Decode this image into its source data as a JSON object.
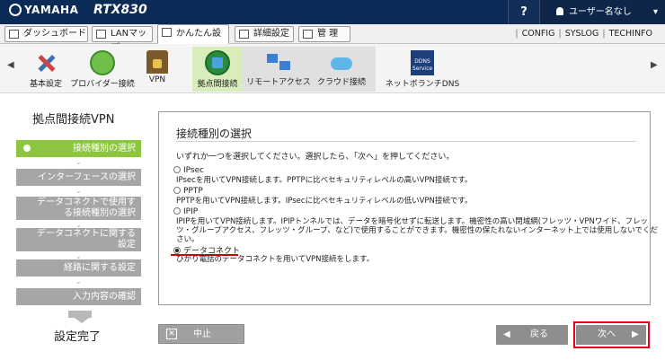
{
  "header": {
    "brand": "YAMAHA",
    "model": "RTX830",
    "help": "?",
    "user": "ユーザー名なし",
    "user_caret": "▾"
  },
  "tabs": [
    {
      "label": "ダッシュボード"
    },
    {
      "label": "LANマップ"
    },
    {
      "label": "かんたん設定"
    },
    {
      "label": "詳細設定"
    },
    {
      "label": "管 理"
    }
  ],
  "links": [
    "CONFIG",
    "SYSLOG",
    "TECHINFO"
  ],
  "icon_strip": {
    "prev": "◀",
    "next": "▶",
    "items": [
      {
        "label": "基本設定",
        "icon": "tools-icon"
      },
      {
        "label": "プロバイダー接続",
        "icon": "globe-icon"
      },
      {
        "label": "VPN",
        "icon": "lock-house-icon"
      },
      {
        "label": "拠点間接続",
        "icon": "site-to-site-icon"
      },
      {
        "label": "リモートアクセス",
        "icon": "remote-access-icon"
      },
      {
        "label": "クラウド接続",
        "icon": "cloud-icon"
      },
      {
        "label": "ネットボランチDNS",
        "icon": "dns-service-icon",
        "badge": "DDNS Service"
      }
    ]
  },
  "wizard": {
    "title": "拠点間接続VPN",
    "steps": [
      {
        "label": "接続種別の選択"
      },
      {
        "label": "インターフェースの選択"
      },
      {
        "line1": "データコネクトで使用す",
        "line2": "る接続種別の選択"
      },
      {
        "line1": "データコネクトに関する",
        "line2": "設定"
      },
      {
        "label": "経路に関する設定"
      },
      {
        "label": "入力内容の確認"
      }
    ],
    "chevron": "⌄",
    "done": "設定完了"
  },
  "main": {
    "title": "接続種別の選択",
    "instruction": "いずれか一つを選択してください。選択したら、「次へ」を押してください。",
    "options": [
      {
        "label": "IPsec",
        "desc": "IPsecを用いてVPN接続します。PPTPに比べセキュリティレベルの高いVPN接続です。",
        "selected": false
      },
      {
        "label": "PPTP",
        "desc": "PPTPを用いてVPN接続します。IPsecに比べセキュリティレベルの低いVPN接続です。",
        "selected": false
      },
      {
        "label": "IPIP",
        "desc1": "IPIPを用いてVPN接続します。IPIPトンネルでは、データを暗号化せずに転送します。機密性の高い閉域網(フレッツ・VPNワイド、フレッ",
        "desc2": "ツ・グループアクセス、フレッツ・グループ、など)で使用することができます。機密性の保たれないインターネット上では使用しないでくだ",
        "desc3": "さい。",
        "selected": false
      },
      {
        "label": "データコネクト",
        "desc": "ひかり電話のデータコネクトを用いてVPN接続をします。",
        "selected": true
      }
    ]
  },
  "buttons": {
    "cancel": "中止",
    "back": "戻る",
    "next": "次へ",
    "back_arrow": "◀",
    "next_arrow": "▶",
    "cancel_icon": "✕"
  },
  "colors": {
    "header_bg": "#0b2a55",
    "active_step": "#8cc63e",
    "highlight_frame": "#e2001a"
  }
}
